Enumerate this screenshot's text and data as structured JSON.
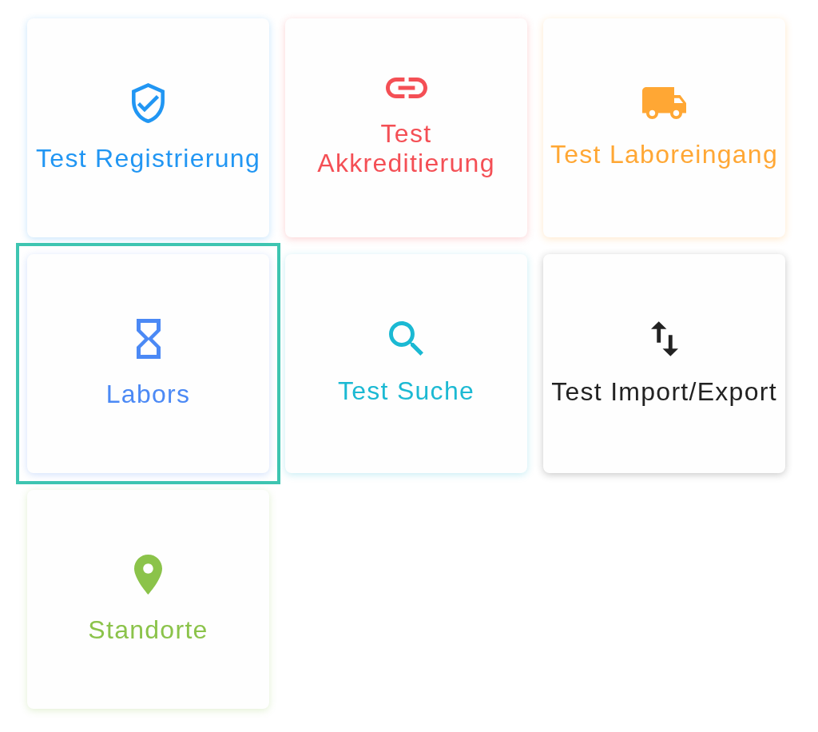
{
  "tiles": [
    {
      "label": "Test Registrierung",
      "color": "#2196f3",
      "selected": false
    },
    {
      "label": "Test\nAkkreditierung",
      "color": "#f44f55",
      "selected": false
    },
    {
      "label": "Test Laboreingang",
      "color": "#ffa734",
      "selected": false
    },
    {
      "label": "Labors",
      "color": "#4b89f5",
      "selected": true
    },
    {
      "label": "Test Suche",
      "color": "#1bb9d3",
      "selected": false
    },
    {
      "label": "Test Import/Export",
      "color": "#222222",
      "selected": false
    },
    {
      "label": "Standorte",
      "color": "#8bc34a",
      "selected": false
    }
  ]
}
